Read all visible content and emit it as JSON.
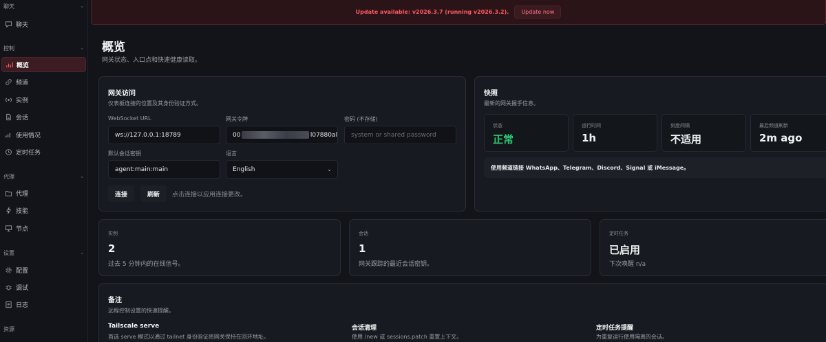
{
  "sidebar": {
    "sections": [
      {
        "label": "聊天",
        "items": [
          {
            "label": "聊天",
            "icon": "chat-icon"
          }
        ]
      },
      {
        "label": "控制",
        "items": [
          {
            "label": "概览",
            "icon": "bar-chart-icon",
            "active": true
          },
          {
            "label": "频道",
            "icon": "link-icon"
          },
          {
            "label": "实例",
            "icon": "radio-icon"
          },
          {
            "label": "会话",
            "icon": "document-icon"
          },
          {
            "label": "使用情况",
            "icon": "usage-chart-icon"
          },
          {
            "label": "定时任务",
            "icon": "clock-icon"
          }
        ]
      },
      {
        "label": "代理",
        "items": [
          {
            "label": "代理",
            "icon": "folder-icon"
          },
          {
            "label": "技能",
            "icon": "lightning-icon"
          },
          {
            "label": "节点",
            "icon": "monitor-icon"
          }
        ]
      },
      {
        "label": "设置",
        "items": [
          {
            "label": "配置",
            "icon": "gear-icon"
          },
          {
            "label": "调试",
            "icon": "bug-icon"
          },
          {
            "label": "日志",
            "icon": "log-icon"
          }
        ]
      },
      {
        "label": "资源",
        "items": []
      }
    ]
  },
  "banner": {
    "text": "Update available: v2026.3.7 (running v2026.3.2).",
    "button": "Update now"
  },
  "page": {
    "title": "概览",
    "subtitle": "网关状态、入口点和快速健康读取。"
  },
  "gateway": {
    "title": "网关访问",
    "subtitle": "仪表板连接的位置及其身份验证方式。",
    "ws_label": "WebSocket URL",
    "ws_value": "ws://127.0.0.1:18789",
    "token_label": "网关令牌",
    "token_prefix": "00",
    "token_suffix": "l07880al",
    "password_label": "密码 (不存储)",
    "password_placeholder": "system or shared password",
    "session_key_label": "默认会话密钥",
    "session_key_value": "agent:main:main",
    "language_label": "语言",
    "language_value": "English",
    "connect_button": "连接",
    "refresh_button": "刷新",
    "hint": "点击连接以应用连接更改。"
  },
  "snapshot": {
    "title": "快照",
    "subtitle": "最新的网关握手信息。",
    "stats": [
      {
        "label": "状态",
        "value": "正常",
        "ok": true
      },
      {
        "label": "运行时间",
        "value": "1h"
      },
      {
        "label": "刻度间隔",
        "value": "不适用"
      },
      {
        "label": "最后频道刷新",
        "value": "2m ago"
      }
    ],
    "note": "使用频道链接 WhatsApp、Telegram、Discord、Signal 或 iMessage。"
  },
  "cards": [
    {
      "label": "实例",
      "value": "2",
      "sub": "过去 5 分钟内的在线信号。"
    },
    {
      "label": "会话",
      "value": "1",
      "sub": "网关跟踪的最近会话密钥。"
    },
    {
      "label": "定时任务",
      "value": "已启用",
      "sub": "下次唤醒 n/a"
    }
  ],
  "notes": {
    "title": "备注",
    "subtitle": "远程控制设置的快速提醒。",
    "items": [
      {
        "title": "Tailscale serve",
        "text": "首选 serve 模式以通过 tailnet 身份验证将网关保持在回环地址。"
      },
      {
        "title": "会话清理",
        "text": "使用 /new 或 sessions.patch 重置上下文。"
      },
      {
        "title": "定时任务提醒",
        "text": "为重复运行使用隔离的会话。"
      }
    ]
  },
  "colors": {
    "background": "#12141a",
    "accent": "#ff5864",
    "ok": "#2ecc71"
  }
}
